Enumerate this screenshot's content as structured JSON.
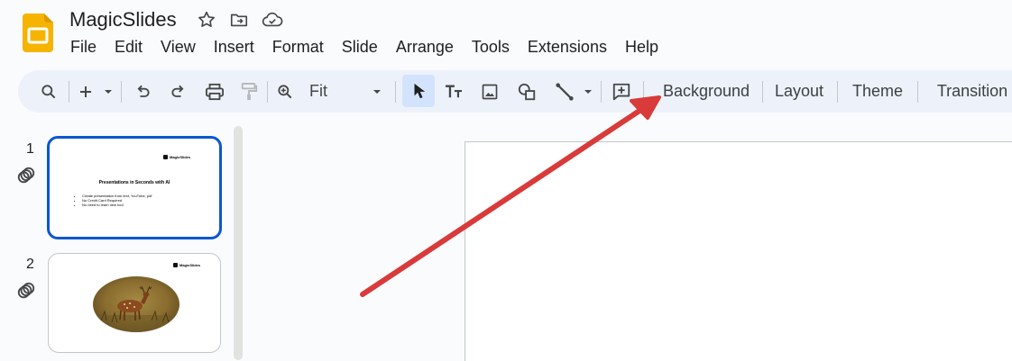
{
  "app": {
    "title": "MagicSlides",
    "icons": [
      "star-icon",
      "move-to-folder-icon",
      "cloud-saved-icon"
    ]
  },
  "menu": [
    "File",
    "Edit",
    "View",
    "Insert",
    "Format",
    "Slide",
    "Arrange",
    "Tools",
    "Extensions",
    "Help"
  ],
  "toolbar": {
    "zoom": "Fit",
    "buttons": {
      "background": "Background",
      "layout": "Layout",
      "theme": "Theme",
      "transition": "Transition"
    },
    "icons": [
      "search-icon",
      "new-slide-plus-icon",
      "dropdown-icon",
      "undo-icon",
      "redo-icon",
      "print-icon",
      "paint-format-icon",
      "zoom-icon",
      "select-cursor-icon",
      "text-box-icon",
      "image-icon",
      "shape-icon",
      "line-icon",
      "comment-icon"
    ]
  },
  "slides": [
    {
      "number": "1",
      "logo": "MagicSlides",
      "title": "Presentations in Seconds with AI",
      "bullets": [
        "Create presentation from text, YouTube, pdf",
        "No Credit Card Required",
        "No need to learn new tool"
      ]
    },
    {
      "number": "2",
      "logo": "MagicSlides"
    }
  ],
  "colors": {
    "accent": "#0b57d0",
    "toolbar_bg": "#edf2fa",
    "active_tool": "#d3e3fd",
    "arrow": "#d93a3a",
    "logo_yellow": "#f6b400"
  }
}
